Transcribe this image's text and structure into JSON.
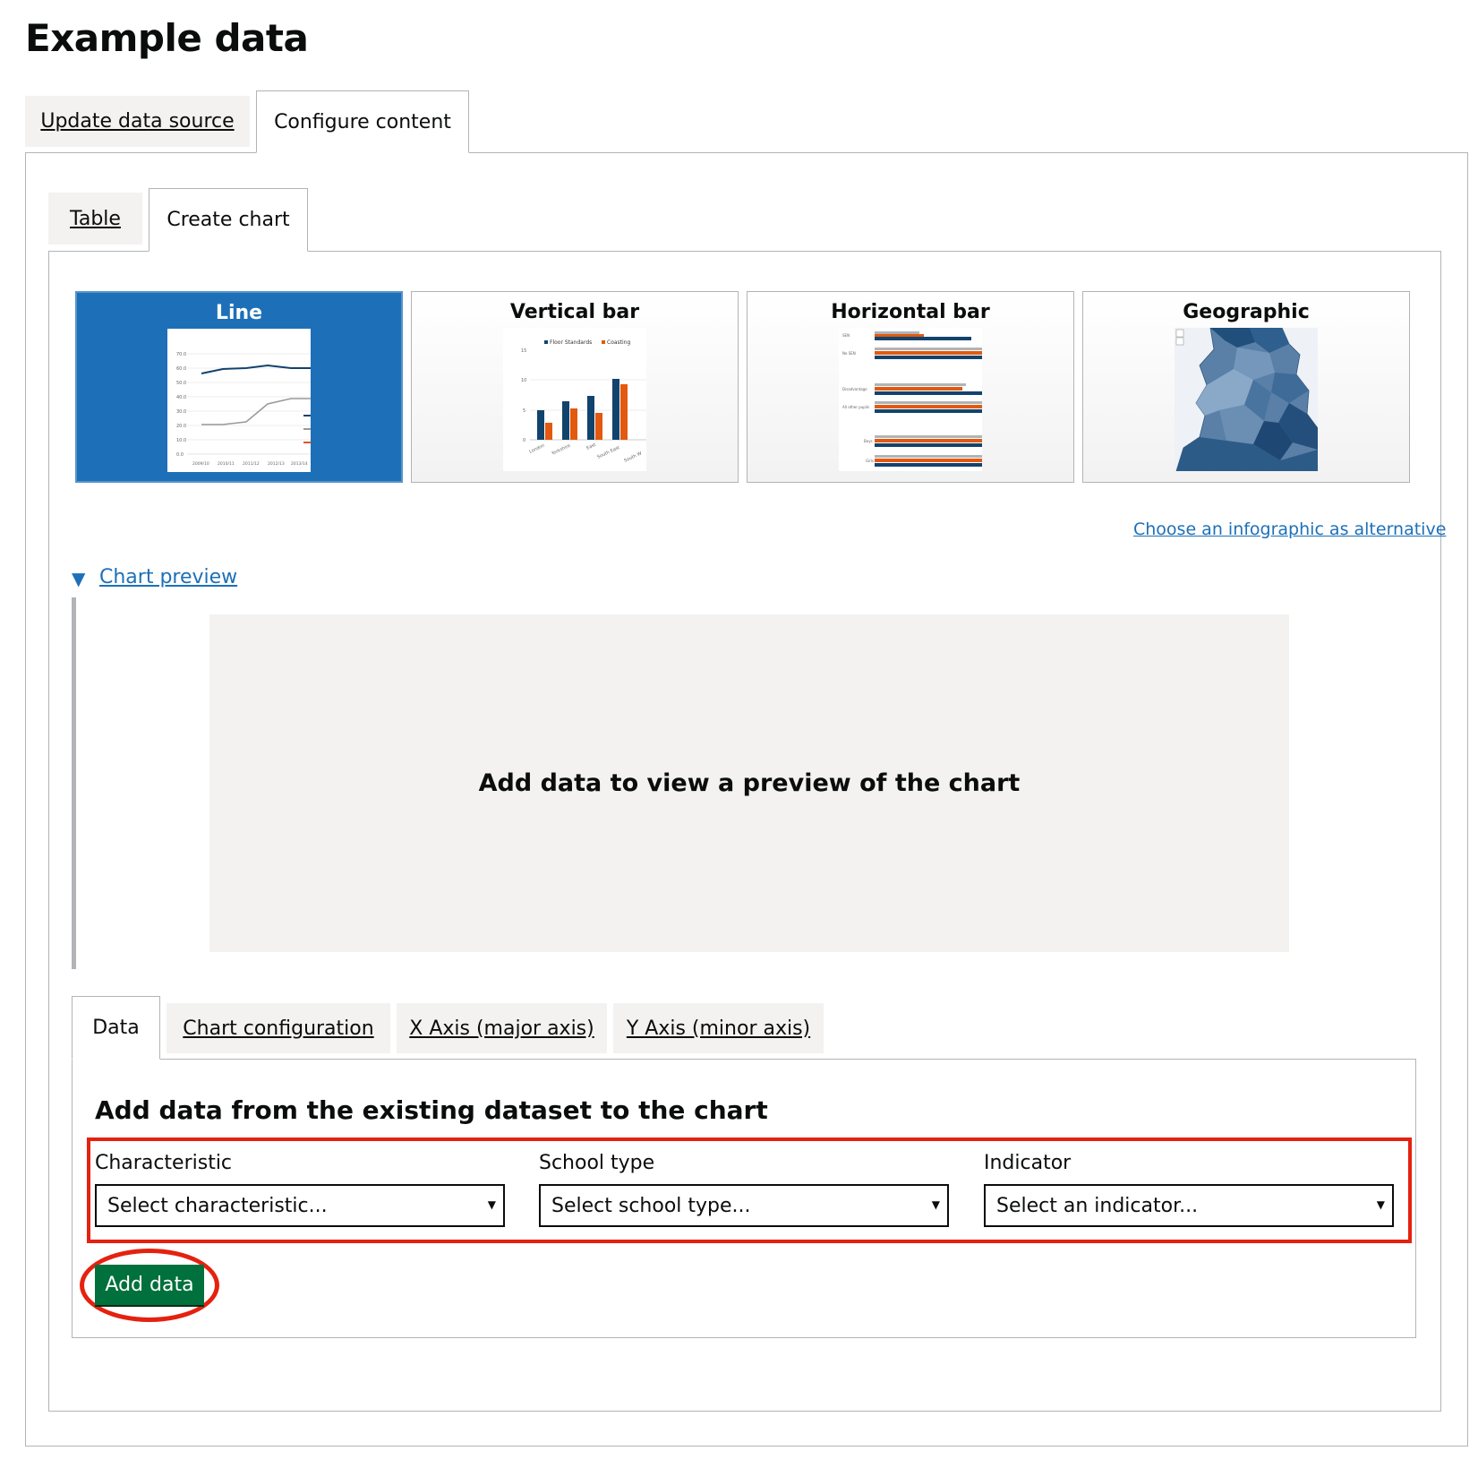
{
  "page": {
    "title": "Example data"
  },
  "top_tabs": [
    {
      "label": "Update data source"
    },
    {
      "label": "Configure content"
    }
  ],
  "sub_tabs": [
    {
      "label": "Table"
    },
    {
      "label": "Create chart"
    }
  ],
  "chart_types": [
    {
      "label": "Line",
      "selected": true
    },
    {
      "label": "Vertical bar",
      "selected": false
    },
    {
      "label": "Horizontal bar",
      "selected": false
    },
    {
      "label": "Geographic",
      "selected": false
    }
  ],
  "thumbnails": {
    "line": {
      "yticks": [
        "70.0",
        "60.0",
        "50.0",
        "40.0",
        "30.0",
        "20.0",
        "10.0",
        "0.0"
      ],
      "xticks": [
        "2009/10",
        "2010/11",
        "2011/12",
        "2012/13",
        "2013/14"
      ]
    },
    "vertical_bar": {
      "legend": [
        "Floor Standards",
        "Coasting"
      ],
      "yticks": [
        "15",
        "10",
        "5",
        "0"
      ],
      "categories": [
        "London",
        "Yorkshire",
        "East",
        "South East",
        "South W"
      ]
    },
    "horizontal_bar": {
      "categories": [
        "SEN",
        "No SEN",
        "Disadvantage",
        "All other pupils",
        "Boys",
        "Girls"
      ]
    }
  },
  "infographic_link": "Choose an infographic as alternative",
  "preview": {
    "toggle_label": "Chart preview",
    "placeholder": "Add data to view a preview of the chart"
  },
  "data_tabs": [
    {
      "label": "Data"
    },
    {
      "label": "Chart configuration"
    },
    {
      "label": "X Axis (major axis)"
    },
    {
      "label": "Y Axis (minor axis)"
    }
  ],
  "data_form": {
    "heading": "Add data from the existing dataset to the chart",
    "fields": [
      {
        "label": "Characteristic",
        "value": "Select characteristic..."
      },
      {
        "label": "School type",
        "value": "Select school type..."
      },
      {
        "label": "Indicator",
        "value": "Select an indicator..."
      }
    ],
    "add_button": "Add data"
  },
  "colors": {
    "accent_blue": "#1d70b8",
    "button_green": "#00703c",
    "highlight_red": "#e5210f",
    "series_navy": "#12436d",
    "series_orange": "#e2590f"
  }
}
